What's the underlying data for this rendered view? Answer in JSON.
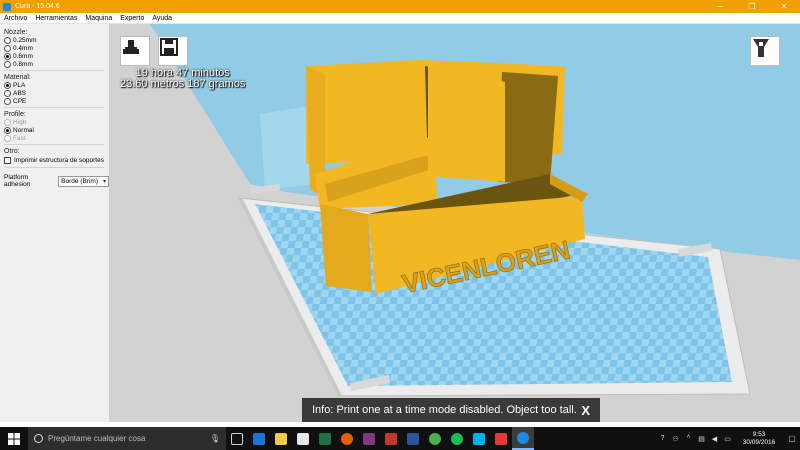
{
  "window": {
    "title": "Cura - 15.04.6",
    "minimize": "─",
    "maximize": "❐",
    "close": "✕"
  },
  "menu": [
    "Archivo",
    "Herramientas",
    "Maquina",
    "Experto",
    "Ayuda"
  ],
  "panel": {
    "nozzle": {
      "label": "Nozzle:",
      "options": [
        "0.25mm",
        "0.4mm",
        "0.6mm",
        "0.8mm"
      ],
      "selected": "0.6mm"
    },
    "material": {
      "label": "Material:",
      "options": [
        "PLA",
        "ABS",
        "CPE"
      ],
      "selected": "PLA"
    },
    "profile": {
      "label": "Profile:",
      "options": [
        "High",
        "Normal",
        "Fast"
      ],
      "selected": "Normal"
    },
    "other": {
      "label": "Otro:",
      "support_label": "Imprimir estructura de soportes",
      "support_checked": false
    },
    "adhesion": {
      "label": "Platform adhesion",
      "value": "Borde (Brim)"
    }
  },
  "viewport": {
    "print_time": "19 hora 47 minutos",
    "print_material": "23.60 metros 187 gramos",
    "model_text": "VICENLOREN",
    "toast_text": "Info: Print one at a time mode disabled. Object too tall.",
    "toast_close": "X"
  },
  "taskbar": {
    "search_placeholder": "Pregúntame cualquier cosa",
    "time": "9:53",
    "date": "30/09/2016",
    "apps": [
      {
        "name": "task-view",
        "color": "#cfcfcf"
      },
      {
        "name": "edge",
        "color": "#1e73d8"
      },
      {
        "name": "file-explorer",
        "color": "#f2c94c"
      },
      {
        "name": "store",
        "color": "#e8e8e8"
      },
      {
        "name": "excel",
        "color": "#1e7145"
      },
      {
        "name": "firefox",
        "color": "#e66000"
      },
      {
        "name": "onenote",
        "color": "#80397b"
      },
      {
        "name": "photos",
        "color": "#c0392b"
      },
      {
        "name": "word",
        "color": "#2b579a"
      },
      {
        "name": "chrome",
        "color": "#4caf50"
      },
      {
        "name": "spotify",
        "color": "#1db954"
      },
      {
        "name": "skype",
        "color": "#00aff0"
      },
      {
        "name": "app-red",
        "color": "#e53935"
      },
      {
        "name": "cura",
        "color": "#1e88e5"
      }
    ]
  },
  "colors": {
    "accent": "#f0a000",
    "model": "#f2b824",
    "bed_blue": "#8ecff0",
    "toast_bg": "#3a3a3a"
  }
}
